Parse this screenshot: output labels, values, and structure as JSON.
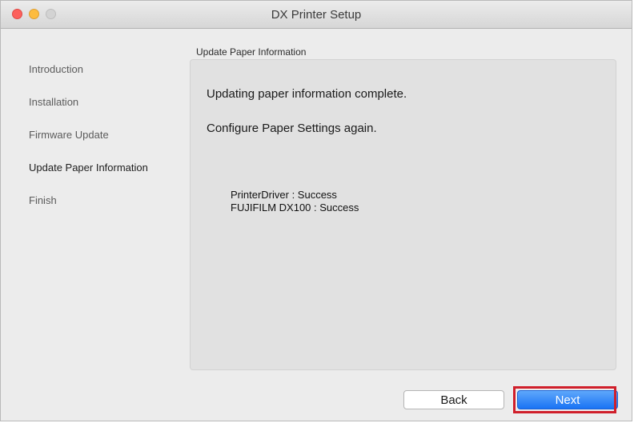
{
  "window": {
    "title": "DX Printer Setup"
  },
  "sidebar": {
    "items": [
      {
        "label": "Introduction"
      },
      {
        "label": "Installation"
      },
      {
        "label": "Firmware Update"
      },
      {
        "label": "Update Paper Information"
      },
      {
        "label": "Finish"
      }
    ],
    "active_index": 3
  },
  "main": {
    "section_title": "Update Paper Information",
    "messages": [
      "Updating paper information complete.",
      "Configure Paper Settings again."
    ],
    "status_lines": [
      "PrinterDriver : Success",
      "FUJIFILM DX100 : Success"
    ]
  },
  "footer": {
    "back_label": "Back",
    "next_label": "Next"
  },
  "colors": {
    "highlight": "#d01f2b",
    "primary_button": "#1973f4",
    "close": "#fc605c",
    "minimize": "#fdbc40"
  }
}
